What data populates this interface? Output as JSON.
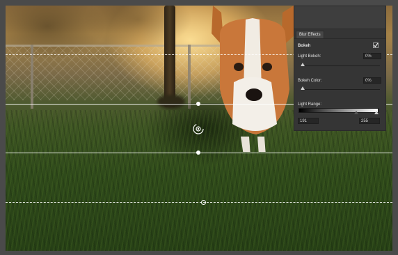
{
  "panel": {
    "tab_label": "Blur Effects",
    "bokeh_label": "Bokeh",
    "bokeh_enabled": true,
    "light_bokeh_label": "Light Bokeh:",
    "light_bokeh_value": "0%",
    "light_bokeh_level": 0,
    "bokeh_color_label": "Bokeh Color:",
    "bokeh_color_value": "0%",
    "bokeh_color_level": 0,
    "light_range_label": "Light Range:",
    "light_range_low": "191",
    "light_range_high": "255"
  },
  "icons": {
    "center_pin": "blur-center-pin-icon",
    "checkbox": "checkmark-icon"
  }
}
